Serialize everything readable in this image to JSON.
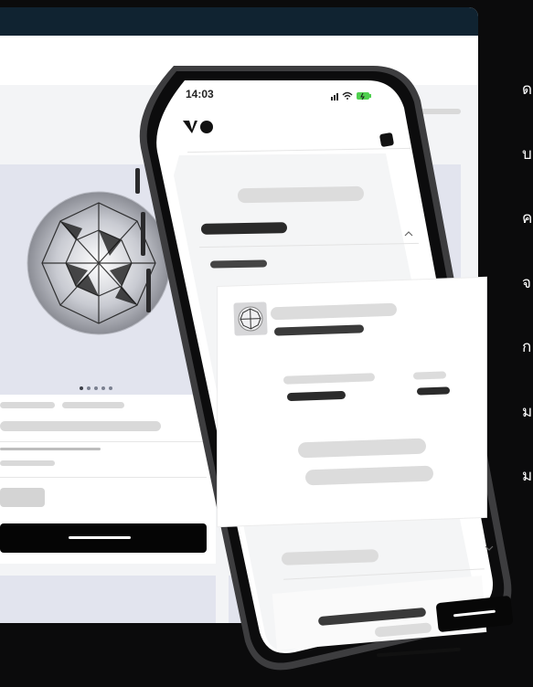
{
  "phone": {
    "status_time": "14:03",
    "logo_text": "VO",
    "icons": {
      "signal": "signal-icon",
      "wifi": "wifi-icon",
      "battery": "battery-charging-icon",
      "menu": "menu-icon",
      "chevron_up": "chevron-up-icon",
      "chevron_down": "chevron-down-icon"
    }
  },
  "desktop": {
    "carousel_dots": 5,
    "active_dot": 0
  },
  "side_text": {
    "chars": [
      "ด",
      "บ",
      "ค",
      "จ",
      "ก",
      "ม",
      "ม"
    ]
  },
  "colors": {
    "background": "#0b0b0c",
    "desktop_topbar": "#102331",
    "hero_bg": "#e2e4ee",
    "cta": "#050505"
  }
}
